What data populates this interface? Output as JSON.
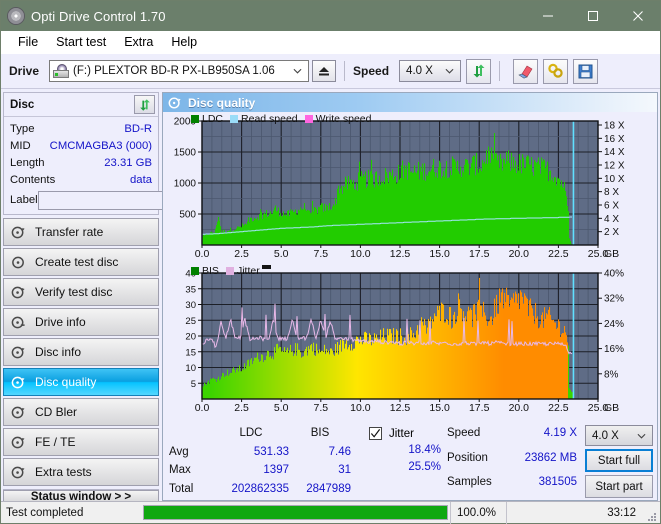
{
  "window": {
    "title": "Opti Drive Control 1.70",
    "icon": "disc-icon",
    "minimize": "minimize-icon",
    "maximize": "maximize-icon",
    "close": "close-icon"
  },
  "menu": {
    "items": [
      "File",
      "Start test",
      "Extra",
      "Help"
    ]
  },
  "toolbar": {
    "drive_label": "Drive",
    "drive_value": "(F:)  PLEXTOR BD-R  PX-LB950SA 1.06",
    "eject_icon": "eject-icon",
    "speed_label": "Speed",
    "speed_value": "4.0 X",
    "refresh_icon": "refresh-icon",
    "erase_icon": "eraser-icon",
    "tools_icon": "tools-icon",
    "save_icon": "save-icon"
  },
  "sidebar": {
    "disc_panel": {
      "title": "Disc",
      "refresh_icon": "refresh-icon",
      "rows": [
        {
          "key": "Type",
          "value": "BD-R"
        },
        {
          "key": "MID",
          "value": "CMCMAGBA3 (000)"
        },
        {
          "key": "Length",
          "value": "23.31 GB"
        },
        {
          "key": "Contents",
          "value": "data"
        }
      ],
      "label_key": "Label",
      "label_value": "",
      "label_placeholder": "",
      "label_button_icon": "disc-label-icon"
    },
    "nav": [
      {
        "label": "Transfer rate",
        "icon": "disc-speed-icon",
        "active": false
      },
      {
        "label": "Create test disc",
        "icon": "disc-burn-icon",
        "active": false
      },
      {
        "label": "Verify test disc",
        "icon": "disc-verify-icon",
        "active": false
      },
      {
        "label": "Drive info",
        "icon": "drive-info-icon",
        "active": false
      },
      {
        "label": "Disc info",
        "icon": "disc-info-icon",
        "active": false
      },
      {
        "label": "Disc quality",
        "icon": "disc-quality-icon",
        "active": true
      },
      {
        "label": "CD Bler",
        "icon": "cd-bler-icon",
        "active": false
      },
      {
        "label": "FE / TE",
        "icon": "fe-te-icon",
        "active": false
      },
      {
        "label": "Extra tests",
        "icon": "extra-tests-icon",
        "active": false
      }
    ],
    "status_window_button": "Status window > >"
  },
  "content": {
    "header_title": "Disc quality",
    "header_icon": "disc-quality-icon"
  },
  "chart_data": [
    {
      "id": "ldc-chart",
      "type": "area",
      "title": "LDC / Read speed",
      "xlabel": "GB",
      "ylabel": "",
      "xlim": [
        0,
        25
      ],
      "ylim": [
        0,
        2000
      ],
      "y2lim": [
        0,
        18
      ],
      "grid": true,
      "legend_position": "top-left",
      "legend": [
        {
          "name": "LDC",
          "color": "#00a800"
        },
        {
          "name": "Read speed",
          "color": "#8ed8f8"
        },
        {
          "name": "Write speed",
          "color": "#ff6ee0"
        }
      ],
      "xticks": [
        "0.0",
        "2.5",
        "5.0",
        "7.5",
        "10.0",
        "12.5",
        "15.0",
        "17.5",
        "20.0",
        "22.5",
        "25.0"
      ],
      "yticks_left": [
        "2000",
        "1500",
        "1000",
        "500"
      ],
      "yticks_right": [
        "18 X",
        "16 X",
        "14 X",
        "12 X",
        "10 X",
        "8 X",
        "6 X",
        "4 X",
        "2 X"
      ],
      "series": [
        {
          "name": "LDC",
          "color": "#22cc00",
          "x": [
            0.0,
            0.2,
            0.4,
            0.6,
            0.8,
            1.0,
            1.2,
            1.4,
            1.6,
            1.8,
            2.0,
            2.2,
            2.4,
            2.6,
            2.8,
            3.0,
            3.2,
            3.4,
            3.6,
            3.8,
            4.0,
            4.2,
            4.4,
            4.6,
            4.8,
            5.0,
            5.2,
            5.4,
            5.6,
            5.8,
            6.0,
            6.2,
            6.4,
            6.6,
            6.8,
            7.0,
            7.2,
            7.4,
            7.6,
            7.8,
            8.0,
            8.2,
            8.4,
            8.6,
            8.8,
            9.0,
            9.2,
            9.4,
            9.6,
            9.8,
            10.0,
            10.4,
            10.8,
            11.2,
            11.6,
            12.0,
            12.4,
            12.8,
            13.2,
            13.6,
            14.0,
            14.4,
            14.8,
            15.2,
            15.6,
            16.0,
            16.4,
            16.8,
            17.2,
            17.6,
            18.0,
            18.4,
            18.8,
            19.2,
            19.6,
            20.0,
            20.4,
            20.8,
            21.2,
            21.6,
            22.0,
            22.4,
            22.8,
            23.1,
            23.3
          ],
          "y": [
            120,
            150,
            175,
            190,
            200,
            470,
            210,
            215,
            225,
            240,
            250,
            260,
            285,
            300,
            330,
            400,
            420,
            430,
            450,
            470,
            480,
            490,
            500,
            560,
            520,
            500,
            480,
            470,
            490,
            510,
            540,
            560,
            580,
            560,
            540,
            520,
            540,
            560,
            580,
            560,
            590,
            620,
            650,
            900,
            880,
            920,
            950,
            960,
            930,
            980,
            1000,
            1020,
            1010,
            1050,
            1060,
            1080,
            1100,
            1190,
            1120,
            1130,
            1150,
            1170,
            1200,
            1180,
            1210,
            1190,
            1220,
            1200,
            1250,
            1230,
            1410,
            1260,
            1240,
            1290,
            1270,
            1250,
            1240,
            1220,
            1200,
            1180,
            1130,
            1050,
            930,
            620,
            60
          ]
        },
        {
          "name": "Read speed",
          "color": "#a6e6ff",
          "x": [
            0.0,
            1.0,
            2.0,
            3.0,
            4.0,
            5.0,
            6.0,
            7.0,
            8.0,
            9.0,
            10.0,
            11.0,
            12.0,
            13.0,
            14.0,
            15.0,
            16.0,
            17.0,
            18.0,
            19.0,
            20.0,
            21.0,
            22.0,
            23.0,
            23.3
          ],
          "y_x": [
            1.6,
            1.7,
            1.9,
            2.1,
            2.3,
            2.5,
            2.6,
            2.7,
            2.9,
            3.0,
            3.1,
            3.2,
            3.3,
            3.4,
            3.5,
            3.6,
            3.7,
            3.8,
            3.9,
            3.95,
            4.0,
            4.05,
            4.1,
            4.15,
            4.19
          ]
        }
      ],
      "write_speed_present": false,
      "end_marker_x": 23.4,
      "end_marker_color": "#60e0ff"
    },
    {
      "id": "bis-jitter-chart",
      "type": "area",
      "title": "BIS / Jitter",
      "xlabel": "GB",
      "ylabel": "",
      "xlim": [
        0,
        25
      ],
      "ylim": [
        0,
        40
      ],
      "y2lim": [
        0,
        40
      ],
      "grid": true,
      "legend_position": "top-left",
      "legend": [
        {
          "name": "BIS",
          "color": "#00a800"
        },
        {
          "name": "Jitter",
          "color": "#e8b8e8"
        }
      ],
      "xticks": [
        "0.0",
        "2.5",
        "5.0",
        "7.5",
        "10.0",
        "12.5",
        "15.0",
        "17.5",
        "20.0",
        "22.5",
        "25.0"
      ],
      "yticks_left": [
        "40",
        "35",
        "30",
        "25",
        "20",
        "15",
        "10",
        "5"
      ],
      "yticks_right": [
        "40%",
        "32%",
        "24%",
        "16%",
        "8%"
      ],
      "series": [
        {
          "name": "BIS",
          "color_low": "#3ad400",
          "color_high": "#ff8000",
          "x": [
            0.0,
            0.3,
            0.6,
            0.9,
            1.2,
            1.5,
            1.8,
            2.1,
            2.4,
            2.7,
            3.0,
            3.3,
            3.6,
            3.9,
            4.2,
            4.5,
            4.8,
            5.1,
            5.4,
            5.7,
            6.0,
            6.3,
            6.6,
            6.9,
            7.2,
            7.5,
            7.8,
            8.1,
            8.4,
            8.7,
            9.0,
            9.4,
            9.8,
            10.2,
            10.6,
            11.0,
            11.4,
            11.8,
            12.2,
            12.6,
            13.0,
            13.4,
            13.8,
            14.2,
            14.6,
            15.0,
            15.4,
            15.8,
            16.2,
            16.6,
            17.0,
            17.4,
            17.8,
            18.2,
            18.6,
            19.0,
            19.4,
            19.8,
            20.2,
            20.6,
            21.0,
            21.4,
            21.8,
            22.2,
            22.6,
            23.0,
            23.3
          ],
          "y": [
            4,
            5,
            6,
            6,
            7,
            8,
            8,
            9,
            9,
            10,
            11,
            12,
            13,
            13,
            14,
            14,
            15,
            14,
            14,
            15,
            15,
            14,
            15,
            16,
            15,
            14,
            15,
            14,
            15,
            16,
            17,
            17,
            18,
            18,
            18,
            18,
            19,
            19,
            19,
            19,
            19,
            20,
            23,
            21,
            25,
            26,
            27,
            24,
            29,
            26,
            25,
            27,
            26,
            24,
            29,
            31,
            28,
            30,
            31,
            27,
            26,
            24,
            25,
            23,
            22,
            20,
            9
          ]
        },
        {
          "name": "Jitter",
          "color": "#e8b8e8",
          "x": [
            0.0,
            0.3,
            0.6,
            0.9,
            1.2,
            1.5,
            1.8,
            2.1,
            2.4,
            2.7,
            3.0,
            3.3,
            3.6,
            3.9,
            4.2,
            4.5,
            4.8,
            5.1,
            5.4,
            5.7,
            6.0,
            6.3,
            6.6,
            6.9,
            7.2,
            7.5,
            7.8,
            8.1,
            8.4,
            8.7,
            9.0,
            9.4,
            9.8,
            10.2,
            10.6,
            11.0,
            11.4,
            11.8,
            12.2,
            12.6,
            13.0,
            13.4,
            13.8,
            14.2,
            14.6,
            15.0,
            15.4,
            15.8,
            16.2,
            16.6,
            17.0,
            17.4,
            17.8,
            18.2,
            18.6,
            19.0,
            19.4,
            19.8,
            20.2,
            20.6,
            21.0,
            21.4,
            21.8,
            22.2,
            22.6,
            23.0,
            23.2
          ],
          "y": [
            17.5,
            18.5,
            19.5,
            16.0,
            25.0,
            19.0,
            25.5,
            19.0,
            19.5,
            25.5,
            19.0,
            19.0,
            19.5,
            19.0,
            19.0,
            25.0,
            19.0,
            19.5,
            19.0,
            25.0,
            19.0,
            19.5,
            19.0,
            25.5,
            19.0,
            25.0,
            19.5,
            25.0,
            19.0,
            19.5,
            19.0,
            19.0,
            18.5,
            18.5,
            18.0,
            18.5,
            18.0,
            18.0,
            18.0,
            17.5,
            18.0,
            17.5,
            18.0,
            17.5,
            18.0,
            17.5,
            18.0,
            17.5,
            17.5,
            18.0,
            17.5,
            17.5,
            18.0,
            17.5,
            18.0,
            17.5,
            17.5,
            17.5,
            17.5,
            17.5,
            17.5,
            17.5,
            17.5,
            17.5,
            17.5,
            17.0,
            14.5
          ]
        }
      ],
      "end_marker_x": 23.4,
      "end_marker_color": "#60e0ff"
    }
  ],
  "stats": {
    "headers": [
      "",
      "LDC",
      "BIS"
    ],
    "rows": [
      {
        "key": "Avg",
        "ldc": "531.33",
        "bis": "7.46"
      },
      {
        "key": "Max",
        "ldc": "1397",
        "bis": "31"
      },
      {
        "key": "Total",
        "ldc": "202862335",
        "bis": "2847989"
      }
    ],
    "jitter": {
      "label": "Jitter",
      "checked": true,
      "avg": "18.4%",
      "max": "25.5%"
    },
    "speed": {
      "key": "Speed",
      "value": "4.19 X"
    },
    "position": {
      "key": "Position",
      "value": "23862 MB"
    },
    "samples": {
      "key": "Samples",
      "value": "381505"
    },
    "speed_select": "4.0 X",
    "start_full": "Start full",
    "start_part": "Start part"
  },
  "statusbar": {
    "text": "Test completed",
    "progress_pct": "100.0%",
    "progress_value": 100,
    "time": "33:12"
  },
  "colors": {
    "titlebar": "#6b7f6b",
    "plot_bg": "#5f6c86",
    "accent_blue": "#1414c8",
    "progress_green": "#10a810",
    "ldc_green": "#22cc00",
    "read_speed": "#a6e6ff",
    "write_speed": "#ff6ee0",
    "jitter_pink": "#e8b8e8"
  }
}
